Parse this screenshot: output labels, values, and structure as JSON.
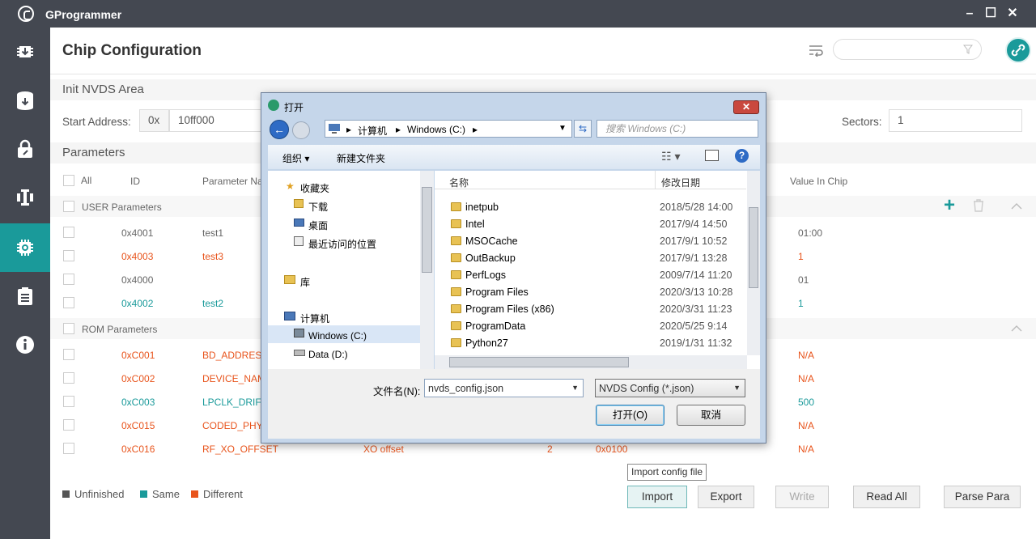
{
  "app": {
    "title": "GProgrammer"
  },
  "page": {
    "title": "Chip Configuration"
  },
  "init_area": {
    "label": "Init NVDS Area",
    "start_address_label": "Start Address:",
    "prefix": "0x",
    "start_address": "10ff000",
    "sectors_label": "Sectors:",
    "sectors": "1"
  },
  "params": {
    "label": "Parameters",
    "headers": {
      "all": "All",
      "id": "ID",
      "param_name": "Parameter Na",
      "value_in_chip": "Value In Chip"
    },
    "user_group": "USER Parameters",
    "rom_group": "ROM Parameters",
    "user_rows": [
      {
        "id": "0x4001",
        "name": "test1",
        "chip": "01:00",
        "status": "gray"
      },
      {
        "id": "0x4003",
        "name": "test3",
        "chip": "1",
        "status": "red"
      },
      {
        "id": "0x4000",
        "name": "",
        "chip": "01",
        "status": "gray"
      },
      {
        "id": "0x4002",
        "name": "test2",
        "chip": "1",
        "status": "teal"
      }
    ],
    "rom_rows": [
      {
        "id": "0xC001",
        "name": "BD_ADDRESS",
        "chip": "N/A",
        "status": "red"
      },
      {
        "id": "0xC002",
        "name": "DEVICE_NAM",
        "chip": "N/A",
        "status": "red"
      },
      {
        "id": "0xC003",
        "name": "LPCLK_DRIFT",
        "chip": "500",
        "status": "teal"
      },
      {
        "id": "0xC015",
        "name": "CODED_PHY_",
        "chip": "N/A",
        "status": "red"
      },
      {
        "id": "0xC016",
        "name": "RF_XO_OFFSET",
        "desc": "XO offset",
        "len": "2",
        "val": "0x0100",
        "chip": "N/A",
        "status": "red"
      }
    ]
  },
  "legend": {
    "unfinished": "Unfinished",
    "same": "Same",
    "different": "Different"
  },
  "actions": {
    "import": "Import",
    "export": "Export",
    "write": "Write",
    "read_all": "Read All",
    "parse_para": "Parse Para",
    "tooltip": "Import config file"
  },
  "dialog": {
    "title": "打开",
    "path": [
      "计算机",
      "Windows (C:)"
    ],
    "search_placeholder": "搜索 Windows (C:)",
    "organize": "组织 ▾",
    "new_folder": "新建文件夹",
    "nav": {
      "favorites": "收藏夹",
      "downloads": "下载",
      "desktop": "桌面",
      "recent": "最近访问的位置",
      "library": "库",
      "computer": "计算机",
      "drive_c": "Windows (C:)",
      "drive_d": "Data (D:)"
    },
    "col_name": "名称",
    "col_date": "修改日期",
    "files": [
      {
        "name": "inetpub",
        "date": "2018/5/28 14:00"
      },
      {
        "name": "Intel",
        "date": "2017/9/4 14:50"
      },
      {
        "name": "MSOCache",
        "date": "2017/9/1 10:52"
      },
      {
        "name": "OutBackup",
        "date": "2017/9/1 13:28"
      },
      {
        "name": "PerfLogs",
        "date": "2009/7/14 11:20"
      },
      {
        "name": "Program Files",
        "date": "2020/3/13 10:28"
      },
      {
        "name": "Program Files (x86)",
        "date": "2020/3/31 11:23"
      },
      {
        "name": "ProgramData",
        "date": "2020/5/25 9:14"
      },
      {
        "name": "Python27",
        "date": "2019/1/31 11:32"
      }
    ],
    "filename_label": "文件名(N):",
    "filename": "nvds_config.json",
    "filetype": "NVDS Config (*.json)",
    "open": "打开(O)",
    "cancel": "取消"
  },
  "colors": {
    "teal": "#1a9a9a",
    "red": "#e8541c",
    "gray": "#666666",
    "sidebar": "#444851"
  }
}
